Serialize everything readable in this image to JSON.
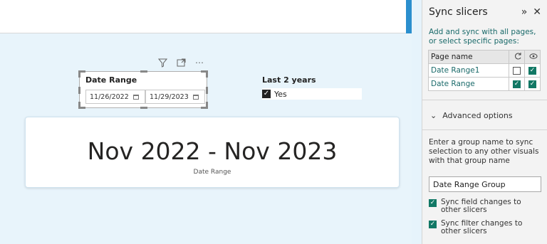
{
  "visual_header": {
    "filter_icon": "filter-icon",
    "focus_icon": "focus-mode-icon",
    "more_label": "⋯"
  },
  "date_slicer": {
    "title": "Date Range",
    "start": "11/26/2022",
    "end": "11/29/2023"
  },
  "last2_slicer": {
    "title": "Last 2 years",
    "option_label": "Yes",
    "checked": true
  },
  "card": {
    "value": "Nov 2022 - Nov 2023",
    "label": "Date Range"
  },
  "sync_pane": {
    "title": "Sync slicers",
    "description": "Add and sync with all pages, or select specific pages:",
    "table_header": "Page name",
    "rows": [
      {
        "name": "Date Range1",
        "sync": false,
        "visible": true
      },
      {
        "name": "Date Range",
        "sync": true,
        "visible": true
      }
    ],
    "advanced_label": "Advanced options",
    "group_desc": "Enter a group name to sync selection to any other visuals with that group name",
    "group_value": "Date Range Group",
    "option1": "Sync field changes to other slicers",
    "option2": "Sync filter changes to other slicers"
  },
  "colors": {
    "accent": "#117865",
    "canvas_bg": "#e8f4fb",
    "scroll_strip": "#2b8fce"
  }
}
